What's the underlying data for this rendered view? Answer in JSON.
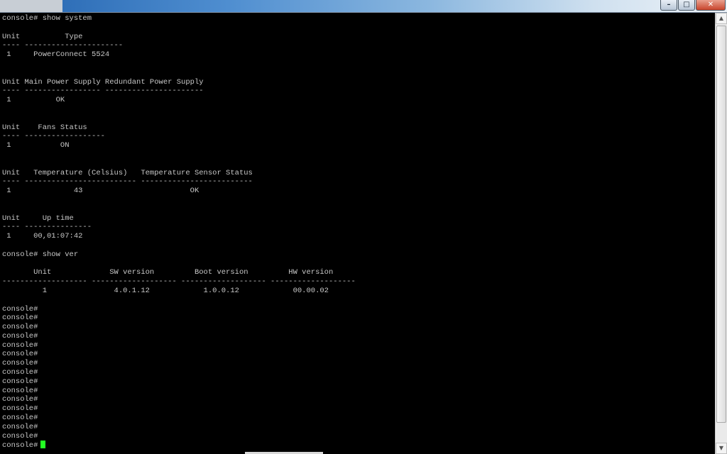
{
  "window": {
    "buttons": {
      "minimize": "–",
      "maximize": "□",
      "close": "✕"
    }
  },
  "terminal": {
    "lines": [
      "console# show system",
      "",
      "Unit          Type",
      "---- ----------------------",
      " 1     PowerConnect 5524",
      "",
      "",
      "Unit Main Power Supply Redundant Power Supply",
      "---- ----------------- ----------------------",
      " 1          OK",
      "",
      "",
      "Unit    Fans Status",
      "---- ------------------",
      " 1           ON",
      "",
      "",
      "Unit   Temperature (Celsius)   Temperature Sensor Status",
      "---- ------------------------- -------------------------",
      " 1              43                        OK",
      "",
      "",
      "Unit     Up time",
      "---- ---------------",
      " 1     00,01:07:42",
      "",
      "console# show ver",
      "",
      "       Unit             SW version         Boot version         HW version",
      "------------------- ------------------- ------------------- -------------------",
      "         1               4.0.1.12            1.0.0.12            00.00.02",
      "",
      "console#",
      "console#",
      "console#",
      "console#",
      "console#",
      "console#",
      "console#",
      "console#",
      "console#",
      "console#",
      "console#",
      "console#",
      "console#",
      "console#",
      "console#",
      "console#"
    ],
    "cursor_color": "#22ff22"
  }
}
